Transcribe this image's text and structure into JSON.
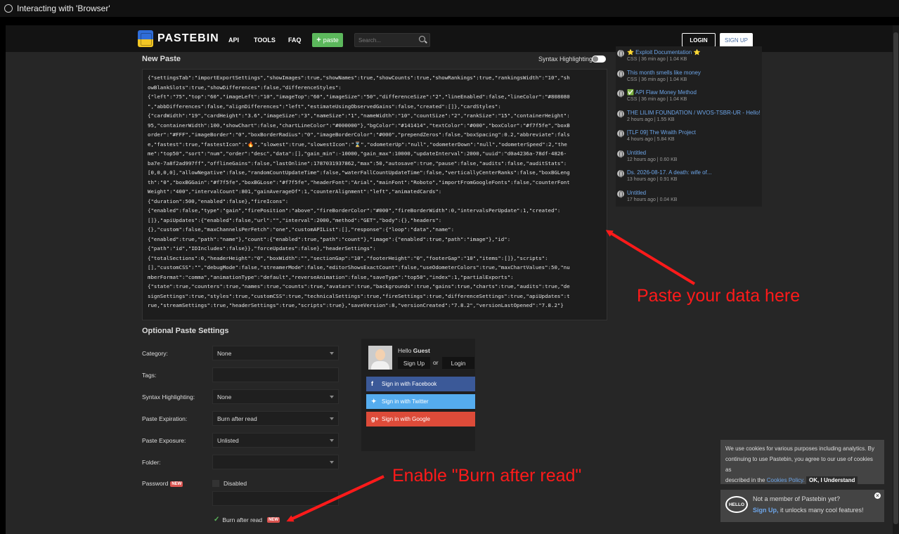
{
  "window": {
    "title": "Interacting with 'Browser'"
  },
  "header": {
    "brand": "PASTEBIN",
    "nav": [
      "API",
      "TOOLS",
      "FAQ"
    ],
    "paste_label": "paste",
    "search_placeholder": "Search...",
    "login": "LOGIN",
    "signup": "SIGN UP"
  },
  "new_paste": {
    "title": "New Paste",
    "syntax_toggle_label": "Syntax Highlighting",
    "code_lines": [
      "{\"settingsTab\":\"importExportSettings\",\"showImages\":true,\"showNames\":true,\"showCounts\":true,\"showRankings\":true,\"rankingsWidth\":\"10\",\"sh",
      "owBlankSlots\":true,\"showDifferences\":false,\"differenceStyles\":",
      "{\"left\":\"75\",\"top\":\"60\",\"imageLeft\":\"10\",\"imageTop\":\"60\",\"imageSize\":\"50\",\"differenceSize\":\"2\",\"lineEnabled\":false,\"lineColor\":\"#808080",
      "\",\"abbDifferences\":false,\"alignDifferences\":\"left\",\"estimateUsingObservedGains\":false,\"created\":[]},\"cardStyles\":",
      "{\"cardWidth\":\"19\",\"cardHeight\":\"3.6\",\"imageSize\":\"3\",\"nameSize\":\"1\",\"nameWidth\":\"10\",\"countSize\":\"2\",\"rankSize\":\"15\",\"containerHeight\":",
      "95,\"containerWidth\":100,\"showChart\":false,\"chartLineColor\":\"#000000\"},\"bgColor\":\"#141414\",\"textColor\":\"#000\",\"boxColor\":\"#f7f5fe\",\"boxB",
      "order\":\"#FFF\",\"imageBorder\":\"0\",\"boxBorderRadius\":\"0\",\"imageBorderColor\":\"#000\",\"prependZeros\":false,\"boxSpacing\":0.2,\"abbreviate\":fals",
      "e,\"fastest\":true,\"fastestIcon\":\"🔥\",\"slowest\":true,\"slowestIcon\":\"⌛\",\"odometerUp\":\"null\",\"odometerDown\":\"null\",\"odometerSpeed\":2,\"the",
      "me\":\"top50\",\"sort\":\"num\",\"order\":\"desc\",\"data\":[],\"gain_min\":-10000,\"gain_max\":10000,\"updateInterval\":2000,\"uuid\":\"d0a4236a-78df-4826-",
      "ba7e-7a8f2ad997ff\",\"offlineGains\":false,\"lastOnline\":1787031937862,\"max\":50,\"autosave\":true,\"pause\":false,\"audits\":false,\"auditStats\":",
      "[0,0,0,0],\"allowNegative\":false,\"randomCountUpdateTime\":false,\"waterFallCountUpdateTime\":false,\"verticallyCenterRanks\":false,\"boxBGLeng",
      "th\":\"0\",\"boxBGGain\":\"#f7f5fe\",\"boxBGLose\":\"#f7f5fe\",\"headerFont\":\"Arial\",\"mainFont\":\"Roboto\",\"importFromGoogleFonts\":false,\"counterFont",
      "Weight\":\"400\",\"intervalCount\":801,\"gainAverageOf\":1,\"counterAlignment\":\"left\",\"animatedCards\":",
      "{\"duration\":500,\"enabled\":false},\"fireIcons\":",
      "{\"enabled\":false,\"type\":\"gain\",\"firePosition\":\"above\",\"fireBorderColor\":\"#000\",\"fireBorderWidth\":0,\"intervalsPerUpdate\":1,\"created\":",
      "[]},\"apiUpdates\":{\"enabled\":false,\"url\":\"\",\"interval\":2000,\"method\":\"GET\",\"body\":{},\"headers\":",
      "{},\"custom\":false,\"maxChannelsPerFetch\":\"one\",\"customAPIList\":[],\"response\":{\"loop\":\"data\",\"name\":",
      "{\"enabled\":true,\"path\":\"name\"},\"count\":{\"enabled\":true,\"path\":\"count\"},\"image\":{\"enabled\":true,\"path\":\"image\"},\"id\":",
      "{\"path\":\"id\",\"IDIncludes\":false}},\"forceUpdates\":false},\"headerSettings\":",
      "{\"totalSections\":0,\"headerHeight\":\"0\",\"boxWidth\":\"\",\"sectionGap\":\"10\",\"footerHeight\":\"0\",\"footerGap\":\"10\",\"items\":[]},\"scripts\":",
      "[],\"customCSS\":\"\",\"debugMode\":false,\"streamerMode\":false,\"editorShowsExactCount\":false,\"useOdometerColors\":true,\"maxChartValues\":50,\"nu",
      "mberFormat\":\"comma\",\"animationType\":\"default\",\"reverseAnimation\":false,\"saveType\":\"top50\",\"index\":1,\"partialExports\":",
      "{\"state\":true,\"counters\":true,\"names\":true,\"counts\":true,\"avatars\":true,\"backgrounds\":true,\"gains\":true,\"charts\":true,\"audits\":true,\"de",
      "signSettings\":true,\"styles\":true,\"customCSS\":true,\"technicalSettings\":true,\"fireSettings\":true,\"differenceSettings\":true,\"apiUpdates\":t",
      "rue,\"streamSettings\":true,\"headerSettings\":true,\"scripts\":true},\"saveVersion\":8,\"versionCreated\":\"7.8.2\",\"versionLastOpened\":\"7.8.2\"}"
    ]
  },
  "recent_pastes": [
    {
      "title": "⭐ Exploit Documentation ⭐",
      "meta": "CSS | 36 min ago | 1.04 KB"
    },
    {
      "title": "This month smells like money",
      "meta": "CSS | 36 min ago | 1.04 KB"
    },
    {
      "title": "✅ API Flaw Money Method",
      "meta": "CSS | 36 min ago | 1.04 KB"
    },
    {
      "title": "THE LILIM FOUNDATION / WVOS-TSBR-UR - Hello!",
      "meta": "2 hours ago | 1.55 KB"
    },
    {
      "title": "[TLF 09] The Wraith Project",
      "meta": "4 hours ago | 5.84 KB"
    },
    {
      "title": "Untitled",
      "meta": "12 hours ago | 0.60 KB"
    },
    {
      "title": "Ds. 2026-08-17. A death: wife of...",
      "meta": "13 hours ago | 0.91 KB"
    },
    {
      "title": "Untitled",
      "meta": "17 hours ago | 0.04 KB"
    }
  ],
  "settings": {
    "title": "Optional Paste Settings",
    "category": {
      "label": "Category:",
      "value": "None"
    },
    "tags": {
      "label": "Tags:",
      "value": ""
    },
    "syntax": {
      "label": "Syntax Highlighting:",
      "value": "None"
    },
    "expiration": {
      "label": "Paste Expiration:",
      "value": "Burn after read"
    },
    "exposure": {
      "label": "Paste Exposure:",
      "value": "Unlisted"
    },
    "folder": {
      "label": "Folder:",
      "value": ""
    },
    "password": {
      "label": "Password",
      "badge": "NEW",
      "value": "Disabled"
    },
    "burn": {
      "label": "Burn after read",
      "badge": "NEW",
      "checked": true
    }
  },
  "guest": {
    "hello": "Hello",
    "name": "Guest",
    "signup": "Sign Up",
    "or": "or",
    "login": "Login",
    "facebook": "Sign in with Facebook",
    "twitter": "Sign in with Twitter",
    "google": "Sign in with Google"
  },
  "annotations": {
    "paste_here": "Paste your data here",
    "enable_burn": "Enable \"Burn after read\""
  },
  "cookie": {
    "text1": "We use cookies for various purposes including analytics. By",
    "text2": "continuing to use Pastebin, you agree to our use of cookies as",
    "text3": "described in the",
    "policy_link": "Cookies Policy.",
    "ok": "OK, I Understand"
  },
  "member_popup": {
    "bubble": "HELLO",
    "line1": "Not a member of Pastebin yet?",
    "signup_link": "Sign Up,",
    "line2": " it unlocks many cool features!"
  },
  "colors": {
    "accent_green": "#5cb85c",
    "annotation_red": "#ff1a1a",
    "link_blue": "#6da5e8",
    "facebook": "#3b5998",
    "twitter": "#55acee",
    "google": "#dd4b39"
  }
}
